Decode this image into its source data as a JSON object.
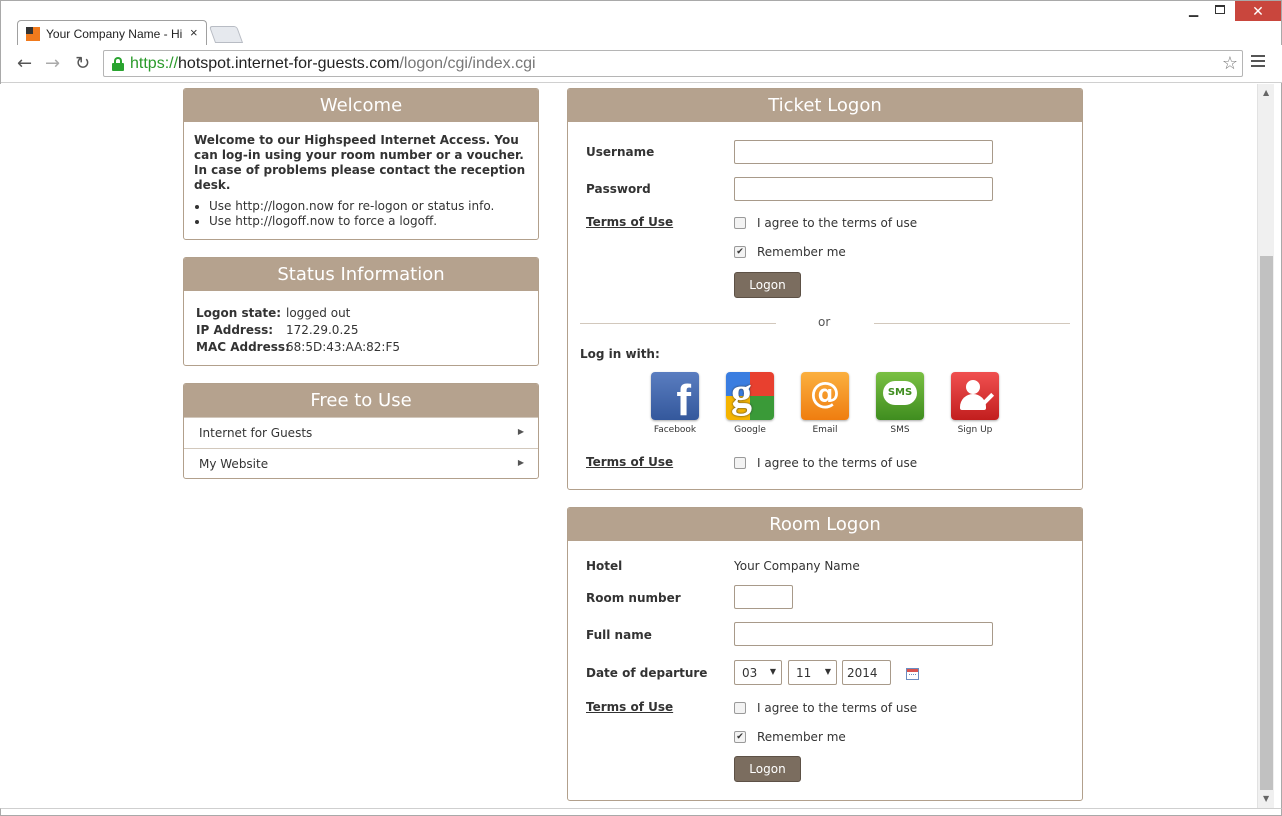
{
  "browser": {
    "tab_title": "Your Company Name - Hi",
    "tab_close": "×",
    "url_scheme": "https://",
    "url_host": "hotspot.internet-for-guests.com",
    "url_path": "/logon/cgi/index.cgi",
    "win_min": "▁",
    "win_close": "✕",
    "back": "←",
    "forward": "→",
    "reload": "↻",
    "star": "☆"
  },
  "welcome": {
    "title": "Welcome",
    "intro": "Welcome to our Highspeed Internet Access. You can log-in using your room number or a voucher. In case of problems please contact the reception desk.",
    "bullets": [
      "Use http://logon.now for re-logon or status info.",
      "Use http://logoff.now to force a logoff."
    ]
  },
  "status": {
    "title": "Status Information",
    "rows": [
      {
        "label": "Logon state:",
        "value": "logged out"
      },
      {
        "label": "IP Address:",
        "value": "172.29.0.25"
      },
      {
        "label": "MAC Address:",
        "value": "68:5D:43:AA:82:F5"
      }
    ]
  },
  "free": {
    "title": "Free to Use",
    "items": [
      {
        "label": "Internet for Guests",
        "arrow": "▶"
      },
      {
        "label": "My Website",
        "arrow": "▶"
      }
    ]
  },
  "ticket": {
    "title": "Ticket Logon",
    "username_label": "Username",
    "password_label": "Password",
    "username_value": "",
    "password_value": "",
    "terms_link": "Terms of Use",
    "agree_label": "I agree to the terms of use",
    "agree_checked": false,
    "remember_label": "Remember me",
    "remember_checked": true,
    "check_mark": "✔",
    "logon_button": "Logon",
    "or": "or",
    "login_with": "Log in with:",
    "social": [
      {
        "label": "Facebook",
        "icon": "facebook-icon",
        "glyph": "f"
      },
      {
        "label": "Google",
        "icon": "google-icon",
        "glyph": "g"
      },
      {
        "label": "Email",
        "icon": "email-icon",
        "glyph": "@"
      },
      {
        "label": "SMS",
        "icon": "sms-icon",
        "glyph": "SMS"
      },
      {
        "label": "Sign Up",
        "icon": "sign-up-icon",
        "glyph": ""
      }
    ],
    "social_terms_link": "Terms of Use",
    "social_agree_label": "I agree to the terms of use"
  },
  "room": {
    "title": "Room Logon",
    "hotel_label": "Hotel",
    "hotel_value": "Your Company Name",
    "room_number_label": "Room number",
    "room_number_value": "",
    "full_name_label": "Full name",
    "full_name_value": "",
    "departure_label": "Date of departure",
    "day": "03",
    "month": "11",
    "year": "2014",
    "dropdown_arrow": "▼",
    "terms_link": "Terms of Use",
    "agree_label": "I agree to the terms of use",
    "remember_label": "Remember me",
    "logon_button": "Logon"
  },
  "colors": {
    "header_bg": "#b5a28e",
    "button_bg": "#7b6d5f",
    "secure_green": "#2aa430"
  }
}
